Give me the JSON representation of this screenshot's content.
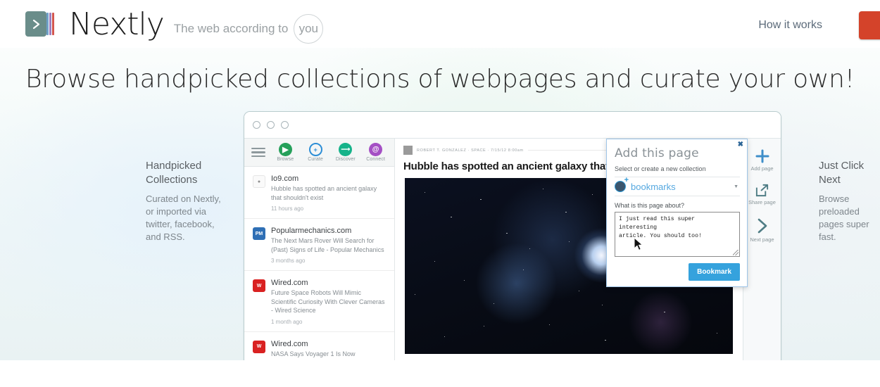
{
  "header": {
    "brand_name": "Nextly",
    "tagline_prefix": "The web according to",
    "tagline_you": "you",
    "nav_link": "How it works",
    "cta_color": "#d4432a",
    "logo_icon": "chevron-right-icon"
  },
  "hero": {
    "headline": "Browse handpicked collections of webpages and curate your own!"
  },
  "captions": {
    "left": {
      "title": "Handpicked Collections",
      "body": "Curated on Nextly, or imported via twitter, facebook, and RSS."
    },
    "right": {
      "title": "Just Click Next",
      "body": "Browse preloaded pages super fast."
    }
  },
  "browser": {
    "traffic_lights": [
      "dot-1",
      "dot-2",
      "dot-3"
    ],
    "toolbar": {
      "menu_icon": "hamburger-menu-icon",
      "items": [
        {
          "label": "Browse",
          "icon": "browse-icon",
          "color": "#25a05a",
          "glyph": "▶"
        },
        {
          "label": "Curate",
          "icon": "curate-icon",
          "color": "#2d8ed6",
          "glyph": "♂"
        },
        {
          "label": "Discover",
          "icon": "discover-icon",
          "color": "#16b38a",
          "glyph": "↗"
        },
        {
          "label": "Connect",
          "icon": "connect-icon",
          "color": "#a44fc4",
          "glyph": "@"
        }
      ]
    },
    "feed": [
      {
        "site": "Io9.com",
        "favicon": "io9-favicon",
        "favicon_color": "#8d8d8d",
        "favicon_text": "",
        "title": "Hubble has spotted an ancient galaxy that shouldn't exist",
        "time": "11 hours ago"
      },
      {
        "site": "Popularmechanics.com",
        "favicon": "popularmechanics-favicon",
        "favicon_color": "#2f6fb5",
        "favicon_text": "PM",
        "title": "The Next Mars Rover Will Search for (Past) Signs of Life - Popular Mechanics",
        "time": "3 months ago"
      },
      {
        "site": "Wired.com",
        "favicon": "wired-favicon",
        "favicon_color": "#d92121",
        "favicon_text": "W",
        "title": "Future Space Robots Will Mimic Scientific Curiosity With Clever Cameras - Wired Science",
        "time": "1 month ago"
      },
      {
        "site": "Wired.com",
        "favicon": "wired-favicon",
        "favicon_color": "#d92121",
        "favicon_text": "W",
        "title": "NASA Says Voyager 1 Is Now",
        "time": ""
      }
    ],
    "article": {
      "byline": "ROBERT T. GONZALEZ · SPACE · 7/15/12 8:00am",
      "title": "Hubble has spotted an ancient galaxy that",
      "image_alt": "galaxy-photo"
    },
    "rail": [
      {
        "label": "Add page",
        "icon": "plus-icon"
      },
      {
        "label": "Share page",
        "icon": "share-external-icon"
      },
      {
        "label": "Next page",
        "icon": "chevron-right-icon"
      }
    ]
  },
  "popup": {
    "title": "Add this page",
    "close_icon": "close-icon",
    "subtitle": "Select or create a new collection",
    "collection_name": "bookmarks",
    "collection_icon": "collection-add-icon",
    "caret_icon": "chevron-down-icon",
    "question_label": "What is this page about?",
    "note_value": "I just read this super interesting\narticle. You should too!",
    "note_placeholder": "",
    "submit_label": "Bookmark",
    "submit_color": "#35a2dd",
    "cursor_icon": "mouse-pointer-icon"
  }
}
